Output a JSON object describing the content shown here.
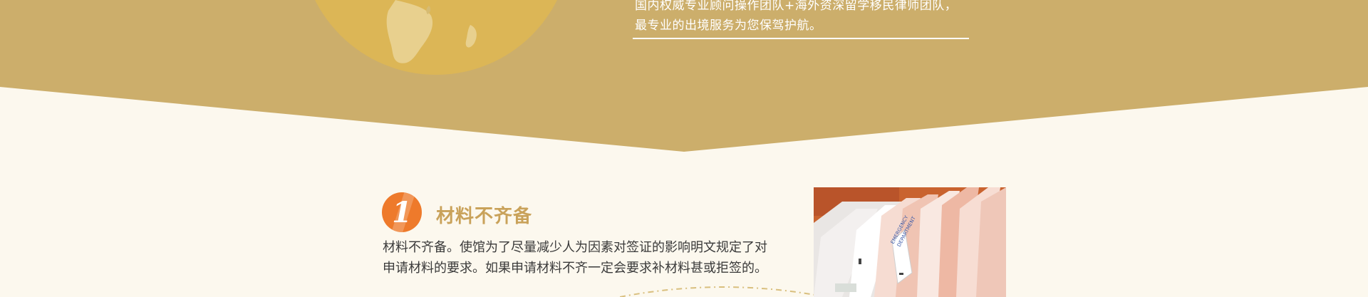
{
  "hero": {
    "line1": "国内权威专业顾问操作团队+海外资深留学移民律师团队，",
    "line2": "最专业的出境服务为您保驾护航。"
  },
  "section1": {
    "number": "1",
    "title": "材料不齐备",
    "desc_line1": "材料不齐备。使馆为了尽量减少人为因素对签证的影响明文规定了对",
    "desc_line2": "申请材料的要求。如果申请材料不齐一定会要求补材料甚或拒签的。"
  },
  "photo": {
    "label_line1": "EMERGENCY",
    "label_line2": "DEPARTMENT"
  },
  "colors": {
    "band": "#ccae6b",
    "background": "#fcf8ee",
    "globe": "#dcb656",
    "continent": "#e8d08e",
    "badge": "#ee7a2b",
    "title": "#c9a25a"
  },
  "icons": {
    "globe": "globe-illustration",
    "number_badge": "number-1-badge"
  }
}
